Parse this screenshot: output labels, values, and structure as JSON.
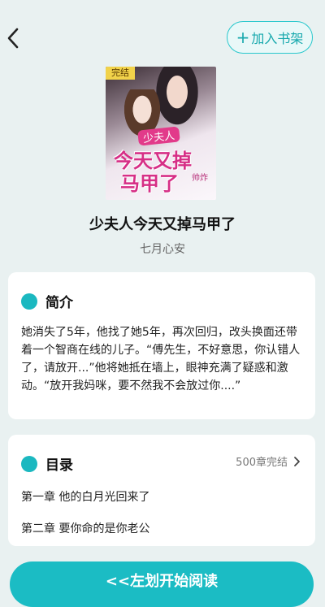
{
  "header": {
    "back_icon": "chevron-left-icon",
    "add_to_shelf_plus": "+",
    "add_to_shelf_label": "加入书架"
  },
  "cover": {
    "badge": "完结",
    "line1": "少夫人",
    "line2": "今天又掉",
    "line3": "马甲了",
    "line4": "帅炸"
  },
  "book": {
    "title": "少夫人今天又掉马甲了",
    "author": "七月心安"
  },
  "intro": {
    "title": "简介",
    "text": "她消失了5年，他找了她5年，再次回归，改头换面还带着一个智商在线的儿子。“傅先生，不好意思，你认错人了，请放开...”他将她抵在墙上，眼神充满了疑惑和激动。“放开我妈咪，要不然我不会放过你....”"
  },
  "toc": {
    "title": "目录",
    "status": "500章完结",
    "chapters": [
      "第一章 他的白月光回来了",
      "第二章 要你命的是你老公"
    ]
  },
  "actions": {
    "read_label": "<<左划开始阅读"
  },
  "colors": {
    "accent": "#1bb8c0",
    "background": "#e9f1f1"
  }
}
